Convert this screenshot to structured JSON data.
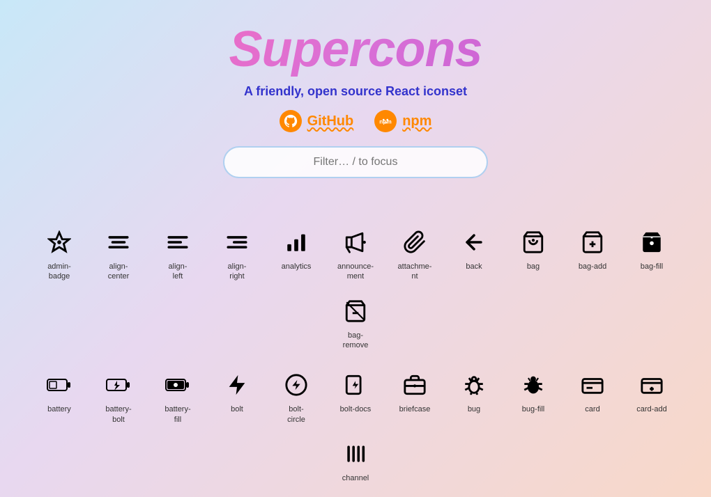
{
  "header": {
    "title": "Supercons",
    "subtitle": "A friendly, open source React iconset",
    "github_label": "GitHub",
    "npm_label": "npm",
    "search_placeholder": "Filter… / to focus"
  },
  "icons_row1": [
    {
      "name": "admin-badge",
      "label": "admin-\nbadge"
    },
    {
      "name": "align-center",
      "label": "align-\ncenter"
    },
    {
      "name": "align-left",
      "label": "align-\nleft"
    },
    {
      "name": "align-right",
      "label": "align-\nright"
    },
    {
      "name": "analytics",
      "label": "analytics"
    },
    {
      "name": "announcement",
      "label": "announce-\nment"
    },
    {
      "name": "attachment",
      "label": "attachme-\nnt"
    },
    {
      "name": "back",
      "label": "back"
    },
    {
      "name": "bag",
      "label": "bag"
    },
    {
      "name": "bag-add",
      "label": "bag-add"
    },
    {
      "name": "bag-fill",
      "label": "bag-fill"
    },
    {
      "name": "bag-remove",
      "label": "bag-\nremove"
    }
  ],
  "icons_row2": [
    {
      "name": "battery",
      "label": "battery"
    },
    {
      "name": "battery-bolt",
      "label": "battery-\nbolt"
    },
    {
      "name": "battery-fill",
      "label": "battery-\nfill"
    },
    {
      "name": "bolt",
      "label": "bolt"
    },
    {
      "name": "bolt-circle",
      "label": "bolt-\ncircle"
    },
    {
      "name": "bolt-docs",
      "label": "bolt-docs"
    },
    {
      "name": "briefcase",
      "label": "briefcase"
    },
    {
      "name": "bug",
      "label": "bug"
    },
    {
      "name": "bug-fill",
      "label": "bug-fill"
    },
    {
      "name": "card",
      "label": "card"
    },
    {
      "name": "card-add",
      "label": "card-add"
    },
    {
      "name": "channel",
      "label": "channel"
    }
  ]
}
